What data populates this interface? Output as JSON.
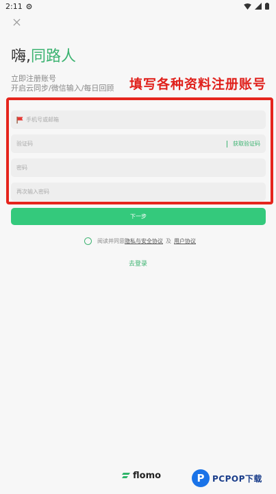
{
  "status_bar": {
    "time": "2:11"
  },
  "header": {
    "greeting_prefix": "嗨,",
    "greeting_accent": "同路人",
    "subtitle_line1": "立即注册账号",
    "subtitle_line2": "开启云同步/微信输入/每日回顾"
  },
  "annotation": {
    "text": "填写各种资料注册账号"
  },
  "form": {
    "phone_placeholder": "手机号或邮箱",
    "code_placeholder": "验证码",
    "get_code_label": "获取验证码",
    "password_placeholder": "密码",
    "confirm_placeholder": "再次输入密码",
    "next_label": "下一步"
  },
  "agreement": {
    "prefix": "阅读并同意",
    "privacy_link": "隐私与安全协议",
    "and": "及",
    "user_link": "用户协议"
  },
  "login_link": "去登录",
  "footer": {
    "logo_text": "flomo"
  },
  "watermark": {
    "text": "PCPOP下载"
  },
  "colors": {
    "accent": "#3cb371",
    "button": "#34c97c",
    "annotation": "#e0201b"
  }
}
